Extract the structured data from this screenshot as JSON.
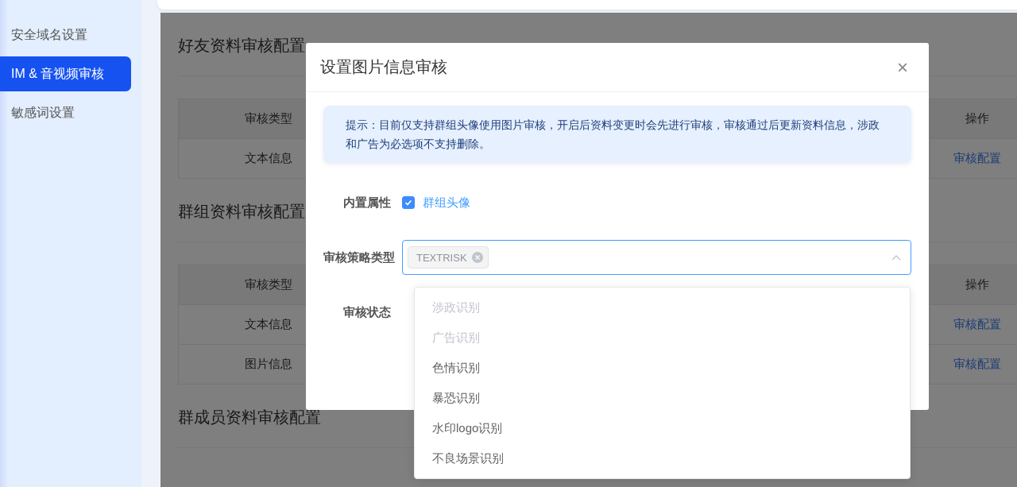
{
  "sidebar": {
    "items": [
      {
        "label": "安全域名设置",
        "selected": false
      },
      {
        "label": "IM & 音视频审核",
        "selected": true
      },
      {
        "label": "敏感词设置",
        "selected": false
      }
    ]
  },
  "sections": [
    {
      "title": "好友资料审核配置",
      "table": {
        "columns": [
          "审核类型",
          "操作"
        ],
        "rows": [
          [
            "文本信息",
            "审核配置"
          ]
        ]
      }
    },
    {
      "title": "群组资料审核配置",
      "table": {
        "columns": [
          "审核类型",
          "操作"
        ],
        "rows": [
          [
            "文本信息",
            "审核配置"
          ],
          [
            "图片信息",
            "审核配置"
          ]
        ]
      }
    },
    {
      "title": "群成员资料审核配置"
    }
  ],
  "dialog": {
    "title": "设置图片信息审核",
    "close": "×",
    "notice": "提示：目前仅支持群组头像使用图片审核，开启后资料变更时会先进行审核，审核通过后更新资料信息，涉政和广告为必选项不支持删除。",
    "fields": [
      {
        "kind": "checkbox",
        "label": "内置属性",
        "option": "群组头像",
        "checked": true
      },
      {
        "kind": "select",
        "label": "审核策略类型",
        "tags": [
          "TEXTRISK"
        ],
        "expanded": true
      },
      {
        "kind": "status",
        "label": "审核状态"
      }
    ],
    "dropdown": [
      {
        "label": "涉政识别",
        "disabled": true
      },
      {
        "label": "广告识别",
        "disabled": true
      },
      {
        "label": "色情识别",
        "disabled": false
      },
      {
        "label": "暴恐识别",
        "disabled": false
      },
      {
        "label": "水印logo识别",
        "disabled": false
      },
      {
        "label": "不良场景识别",
        "disabled": false
      }
    ]
  }
}
